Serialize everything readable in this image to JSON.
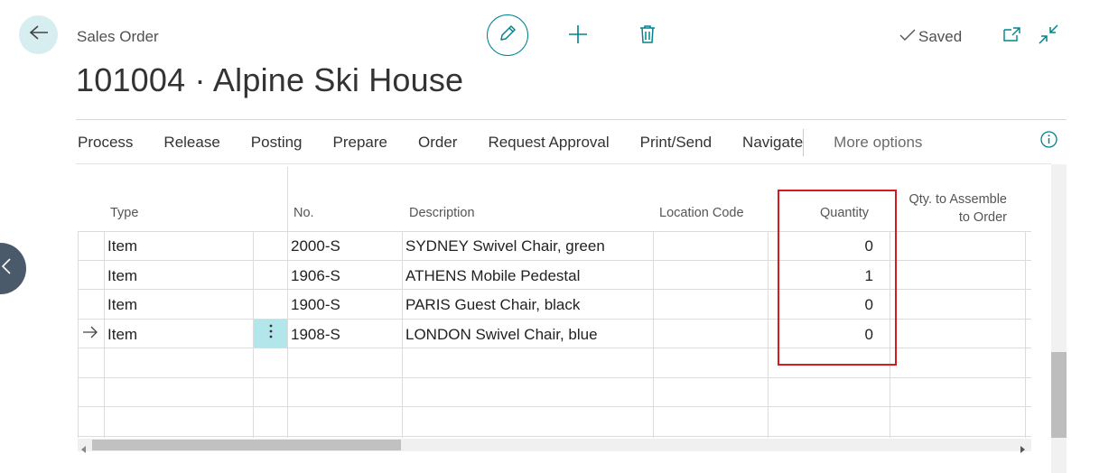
{
  "header": {
    "caption": "Sales Order",
    "title": "101004 · Alpine Ski House",
    "saved_label": "Saved"
  },
  "icons": {
    "back": "arrow-left-icon",
    "edit": "pencil-icon",
    "new": "plus-icon",
    "delete": "trash-icon",
    "open_new_window": "open-in-new-window-icon",
    "collapse": "collapse-icon",
    "info": "info-icon",
    "side_handle": "chevron-left-icon",
    "row_menu": "vertical-ellipsis-icon",
    "current_row": "arrow-right-icon"
  },
  "actions": [
    "Process",
    "Release",
    "Posting",
    "Prepare",
    "Order",
    "Request Approval",
    "Print/Send",
    "Navigate"
  ],
  "more_options": "More options",
  "columns": {
    "type": "Type",
    "no": "No.",
    "description": "Description",
    "location": "Location Code",
    "quantity": "Quantity",
    "qty_assemble_line1": "Qty. to Assemble",
    "qty_assemble_line2": "to Order"
  },
  "rows": [
    {
      "type": "Item",
      "no": "2000-S",
      "description": "SYDNEY Swivel Chair, green",
      "location": "",
      "quantity": "0",
      "current": false
    },
    {
      "type": "Item",
      "no": "1906-S",
      "description": "ATHENS Mobile Pedestal",
      "location": "",
      "quantity": "1",
      "current": false
    },
    {
      "type": "Item",
      "no": "1900-S",
      "description": "PARIS Guest Chair, black",
      "location": "",
      "quantity": "0",
      "current": false
    },
    {
      "type": "Item",
      "no": "1908-S",
      "description": "LONDON Swivel Chair, blue",
      "location": "",
      "quantity": "0",
      "current": true
    }
  ],
  "colors": {
    "accent": "#00838f",
    "highlight_border": "#d71920",
    "selected_cell": "#b2e6eb",
    "back_button_bg": "#d6eef0"
  }
}
